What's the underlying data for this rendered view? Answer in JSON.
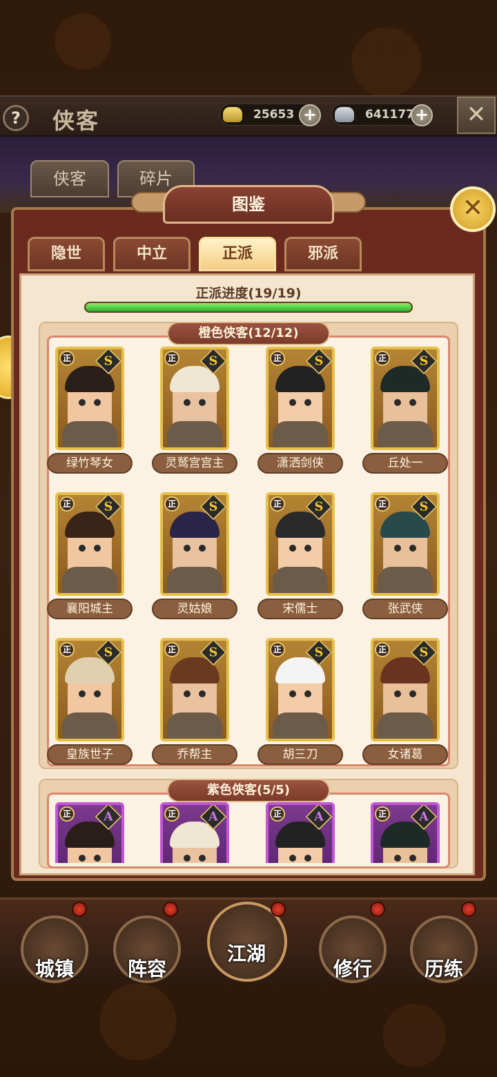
{
  "header": {
    "help_label": "?",
    "title": "侠客",
    "currencies": [
      {
        "icon": "gold-ingot-icon",
        "value": "25653"
      },
      {
        "icon": "silver-ingot-icon",
        "value": "641177"
      }
    ],
    "plus_label": "+",
    "close_label": "✕"
  },
  "outer_tabs": [
    "侠客",
    "碎片"
  ],
  "panel": {
    "title": "图鉴",
    "close_label": "✕",
    "faction_tabs": [
      {
        "label": "隐世",
        "active": false
      },
      {
        "label": "中立",
        "active": false
      },
      {
        "label": "正派",
        "active": true
      },
      {
        "label": "邪派",
        "active": false
      }
    ],
    "progress": {
      "label": "正派进度(19/19)",
      "fraction": 1.0
    }
  },
  "sections": [
    {
      "title": "橙色侠客(12/12)",
      "rarity": "orange",
      "heroes": [
        {
          "name": "绿竹琴女",
          "faction": "正",
          "grade": "S"
        },
        {
          "name": "灵鹫宫宫主",
          "faction": "正",
          "grade": "S"
        },
        {
          "name": "潇洒剑侠",
          "faction": "正",
          "grade": "S"
        },
        {
          "name": "丘处一",
          "faction": "正",
          "grade": "S"
        },
        {
          "name": "襄阳城主",
          "faction": "正",
          "grade": "S"
        },
        {
          "name": "灵姑娘",
          "faction": "正",
          "grade": "S"
        },
        {
          "name": "宋儒士",
          "faction": "正",
          "grade": "S"
        },
        {
          "name": "张武侠",
          "faction": "正",
          "grade": "S"
        },
        {
          "name": "皇族世子",
          "faction": "正",
          "grade": "S"
        },
        {
          "name": "乔帮主",
          "faction": "正",
          "grade": "S"
        },
        {
          "name": "胡三刀",
          "faction": "正",
          "grade": "S"
        },
        {
          "name": "女诸葛",
          "faction": "正",
          "grade": "S"
        }
      ]
    },
    {
      "title": "紫色侠客(5/5)",
      "rarity": "purple",
      "heroes": [
        {
          "faction": "正",
          "grade": "A"
        },
        {
          "faction": "正",
          "grade": "A"
        },
        {
          "faction": "正",
          "grade": "A"
        },
        {
          "faction": "正",
          "grade": "A"
        }
      ]
    }
  ],
  "bottom_nav": [
    {
      "label": "城镇",
      "icon": "town-icon"
    },
    {
      "label": "阵容",
      "icon": "lineup-icon"
    },
    {
      "label": "江湖",
      "icon": "jianghu-scroll-icon"
    },
    {
      "label": "修行",
      "icon": "cultivation-icon"
    },
    {
      "label": "历练",
      "icon": "training-icon"
    }
  ],
  "colors": {
    "orange_card_border": "#e6c04b",
    "purple_card_border": "#c456d6",
    "progress_fill": "#2fb12a",
    "active_tab": "#f4cf83"
  }
}
